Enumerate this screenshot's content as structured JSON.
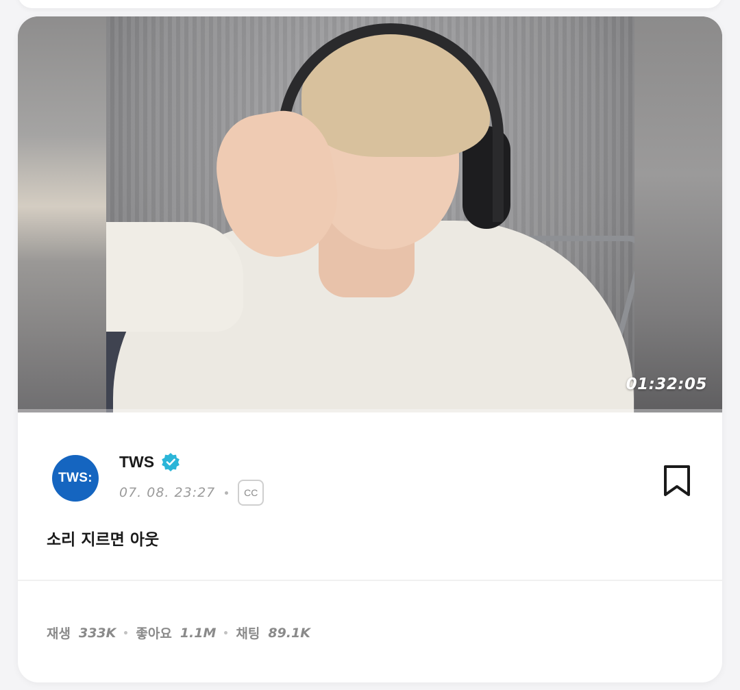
{
  "video": {
    "duration": "01:32:05"
  },
  "channel": {
    "avatar_text": "TWS:",
    "name": "TWS",
    "verified_icon": "verified-badge-icon",
    "date": "07. 08. 23:27",
    "cc_label": "CC"
  },
  "post": {
    "title": "소리 지르면 아웃"
  },
  "stats": {
    "plays_label": "재생",
    "plays_value": "333K",
    "likes_label": "좋아요",
    "likes_value": "1.1M",
    "chats_label": "채팅",
    "chats_value": "89.1K"
  },
  "colors": {
    "avatar_bg": "#1565c0",
    "verified": "#2bb5d8"
  }
}
